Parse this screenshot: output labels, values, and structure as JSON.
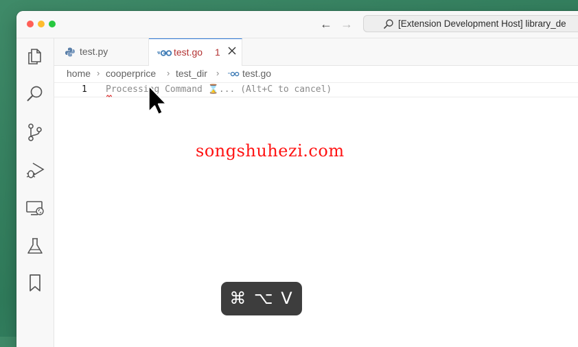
{
  "window": {
    "command_center": "[Extension Development Host] library_de"
  },
  "tabs": [
    {
      "label": "test.py",
      "active": false
    },
    {
      "label": "test.go",
      "active": true,
      "problems": "1"
    }
  ],
  "breadcrumb": [
    "home",
    "cooperprice",
    "test_dir",
    "test.go"
  ],
  "editor": {
    "line_number": "1",
    "line_text": "Processing Command ⌛... (Alt+C to cancel)"
  },
  "overlay": {
    "watermark": "songshuhezi.com",
    "keycast": "⌘ ⌥ V"
  },
  "colors": {
    "accent": "#2f7bd9",
    "error": "#b33232",
    "watermark": "#ff1212"
  }
}
